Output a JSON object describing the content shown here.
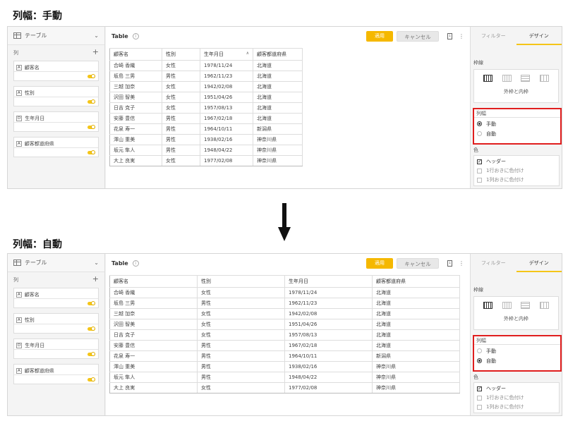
{
  "panels": [
    {
      "heading": "列幅：手動",
      "table_selector": "テーブル",
      "columns_label": "列",
      "add_symbol": "+",
      "fields": [
        {
          "type": "A",
          "name": "顧客名"
        },
        {
          "type": "A",
          "name": "性別"
        },
        {
          "type": "D",
          "name": "生年月日"
        },
        {
          "type": "A",
          "name": "顧客都道府県"
        }
      ],
      "title": "Table",
      "apply": "適用",
      "cancel": "キャンセル",
      "headers": [
        "顧客名",
        "性別",
        "生年月日",
        "顧客都道府県"
      ],
      "rows": [
        [
          "合崎 香織",
          "女性",
          "1978/11/24",
          "北海道"
        ],
        [
          "坂島 三男",
          "男性",
          "1962/11/23",
          "北海道"
        ],
        [
          "三越 加奈",
          "女性",
          "1942/02/08",
          "北海道"
        ],
        [
          "沢田 智美",
          "女性",
          "1951/04/26",
          "北海道"
        ],
        [
          "日吉 克子",
          "女性",
          "1957/08/13",
          "北海道"
        ],
        [
          "安藤 豊信",
          "男性",
          "1967/02/18",
          "北海道"
        ],
        [
          "花泉 寿一",
          "男性",
          "1964/10/11",
          "新潟県"
        ],
        [
          "澤山 重美",
          "男性",
          "1938/02/16",
          "神奈川県"
        ],
        [
          "坂元 隼人",
          "男性",
          "1948/04/22",
          "神奈川県"
        ],
        [
          "大上 良実",
          "女性",
          "1977/02/08",
          "神奈川県"
        ]
      ],
      "tabs": [
        "フィルター",
        "デザイン"
      ],
      "border_label": "枠線",
      "border_caption": "外枠と内枠",
      "colwidth_label": "列幅",
      "radio_manual": "手動",
      "radio_auto": "自動",
      "radio_selected": "手動",
      "color_label": "色",
      "checks": [
        {
          "label": "ヘッダー",
          "checked": true
        },
        {
          "label": "1行おきに色付け",
          "checked": false
        },
        {
          "label": "1列おきに色付け",
          "checked": false
        }
      ]
    },
    {
      "heading": "列幅：自動",
      "table_selector": "テーブル",
      "columns_label": "列",
      "add_symbol": "+",
      "fields": [
        {
          "type": "A",
          "name": "顧客名"
        },
        {
          "type": "A",
          "name": "性別"
        },
        {
          "type": "D",
          "name": "生年月日"
        },
        {
          "type": "A",
          "name": "顧客都道府県"
        }
      ],
      "title": "Table",
      "apply": "適用",
      "cancel": "キャンセル",
      "headers": [
        "顧客名",
        "性別",
        "生年月日",
        "顧客都道府県"
      ],
      "rows": [
        [
          "合崎 香織",
          "女性",
          "1978/11/24",
          "北海道"
        ],
        [
          "坂島 三男",
          "男性",
          "1962/11/23",
          "北海道"
        ],
        [
          "三越 加奈",
          "女性",
          "1942/02/08",
          "北海道"
        ],
        [
          "沢田 智美",
          "女性",
          "1951/04/26",
          "北海道"
        ],
        [
          "日吉 克子",
          "女性",
          "1957/08/13",
          "北海道"
        ],
        [
          "安藤 豊信",
          "男性",
          "1967/02/18",
          "北海道"
        ],
        [
          "花泉 寿一",
          "男性",
          "1964/10/11",
          "新潟県"
        ],
        [
          "澤山 重美",
          "男性",
          "1938/02/16",
          "神奈川県"
        ],
        [
          "坂元 隼人",
          "男性",
          "1948/04/22",
          "神奈川県"
        ],
        [
          "大上 良実",
          "女性",
          "1977/02/08",
          "神奈川県"
        ]
      ],
      "tabs": [
        "フィルター",
        "デザイン"
      ],
      "border_label": "枠線",
      "border_caption": "外枠と内枠",
      "colwidth_label": "列幅",
      "radio_manual": "手動",
      "radio_auto": "自動",
      "radio_selected": "自動",
      "color_label": "色",
      "checks": [
        {
          "label": "ヘッダー",
          "checked": true
        },
        {
          "label": "1行おきに色付け",
          "checked": false
        },
        {
          "label": "1列おきに色付け",
          "checked": false
        }
      ]
    }
  ]
}
